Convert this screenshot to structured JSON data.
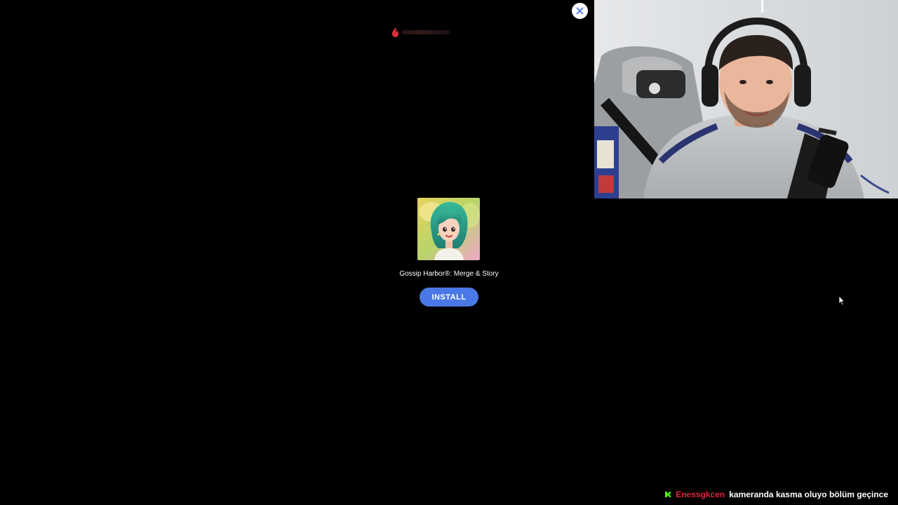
{
  "ad": {
    "app_title": "Gossip Harbor®: Merge & Story",
    "install_label": "INSTALL",
    "accent_color": "#4a78e6",
    "close_icon": "close-icon"
  },
  "chat": {
    "badge_icon": "kick-badge-icon",
    "badge_color": "#53fc18",
    "username": "Enessgkcen",
    "username_color": "#e0243b",
    "message": "kameranda kasma oluyo bölüm geçince"
  }
}
